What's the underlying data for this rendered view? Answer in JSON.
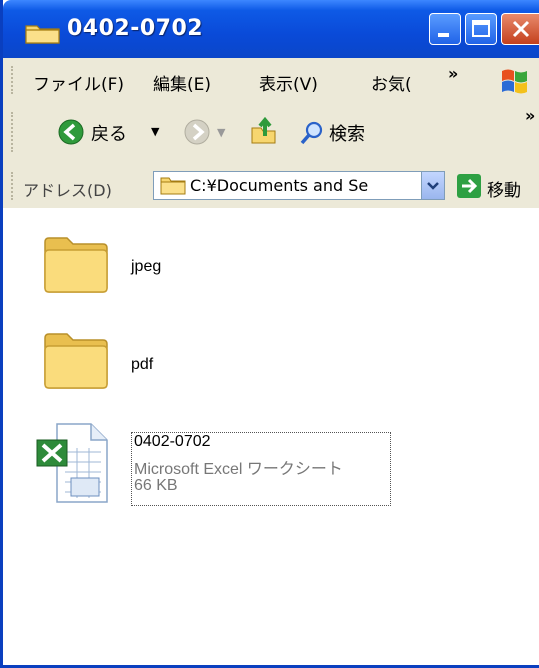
{
  "window": {
    "title": "0402-0702"
  },
  "menubar": {
    "items": [
      "ファイル(F)",
      "編集(E)",
      "表示(V)",
      "お気("
    ],
    "overflow": "»"
  },
  "toolbar": {
    "back_label": "戻る",
    "search_label": "検索",
    "overflow": "»"
  },
  "addressbar": {
    "label": "アドレス(D)",
    "value": "C:¥Documents and Se",
    "go_label": "移動"
  },
  "files": [
    {
      "name": "jpeg",
      "kind": "folder"
    },
    {
      "name": "pdf",
      "kind": "folder"
    },
    {
      "name": "0402-0702",
      "type": "Microsoft Excel ワークシート",
      "size": "66 KB",
      "kind": "excel",
      "selected": true
    }
  ],
  "colors": {
    "titlebar": "#0a4ad8",
    "chrome": "#ece9d8",
    "close_button": "#c4401d",
    "folder": "#f5d36b"
  }
}
